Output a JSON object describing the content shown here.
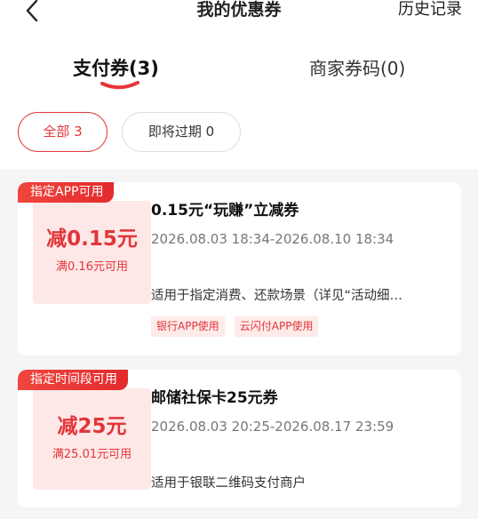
{
  "header": {
    "title": "我的优惠券",
    "history_label": "历史记录",
    "back_icon": "chevron-left-icon"
  },
  "tabs": [
    {
      "label": "支付券(3)",
      "active": true
    },
    {
      "label": "商家券码(0)",
      "active": false
    }
  ],
  "filters": [
    {
      "label": "全部 3",
      "active": true
    },
    {
      "label": "即将过期 0",
      "active": false
    }
  ],
  "coupons": [
    {
      "tag": "指定APP可用",
      "amount": "减0.15元",
      "condition": "满0.16元可用",
      "name": "0.15元“玩赚”立减券",
      "period": "2026.08.03 18:34-2026.08.10 18:34",
      "usage": "适用于指定消费、还款场景（详见“活动细…",
      "badges": [
        "银行APP使用",
        "云闪付APP使用"
      ]
    },
    {
      "tag": "指定时间段可用",
      "amount": "减25元",
      "condition": "满25.01元可用",
      "name": "邮储社保卡25元券",
      "period": "2026.08.03 20:25-2026.08.17 23:59",
      "usage": "适用于银联二维码支付商户",
      "badges": []
    }
  ],
  "colors": {
    "accent": "#e3353a",
    "accent_light": "#fde8e7",
    "background": "#f5f5f5"
  }
}
